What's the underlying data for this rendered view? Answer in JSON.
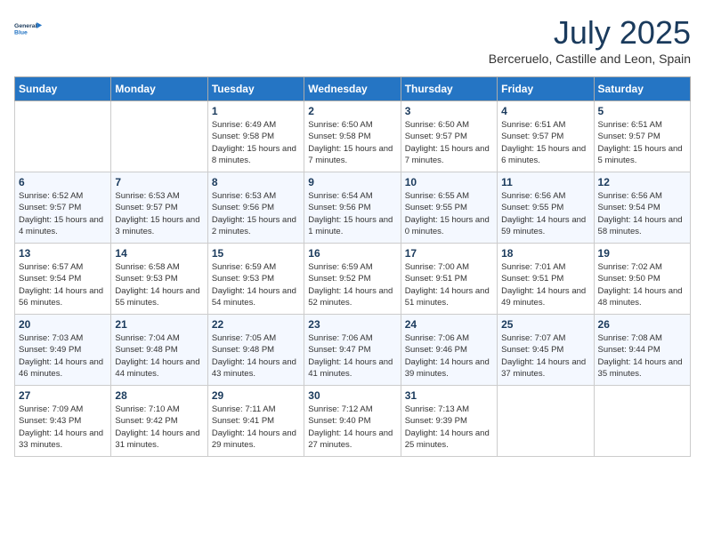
{
  "header": {
    "logo_line1": "General",
    "logo_line2": "Blue",
    "month": "July 2025",
    "location": "Berceruelo, Castille and Leon, Spain"
  },
  "days_of_week": [
    "Sunday",
    "Monday",
    "Tuesday",
    "Wednesday",
    "Thursday",
    "Friday",
    "Saturday"
  ],
  "weeks": [
    [
      {
        "num": "",
        "info": ""
      },
      {
        "num": "",
        "info": ""
      },
      {
        "num": "1",
        "info": "Sunrise: 6:49 AM\nSunset: 9:58 PM\nDaylight: 15 hours and 8 minutes."
      },
      {
        "num": "2",
        "info": "Sunrise: 6:50 AM\nSunset: 9:58 PM\nDaylight: 15 hours and 7 minutes."
      },
      {
        "num": "3",
        "info": "Sunrise: 6:50 AM\nSunset: 9:57 PM\nDaylight: 15 hours and 7 minutes."
      },
      {
        "num": "4",
        "info": "Sunrise: 6:51 AM\nSunset: 9:57 PM\nDaylight: 15 hours and 6 minutes."
      },
      {
        "num": "5",
        "info": "Sunrise: 6:51 AM\nSunset: 9:57 PM\nDaylight: 15 hours and 5 minutes."
      }
    ],
    [
      {
        "num": "6",
        "info": "Sunrise: 6:52 AM\nSunset: 9:57 PM\nDaylight: 15 hours and 4 minutes."
      },
      {
        "num": "7",
        "info": "Sunrise: 6:53 AM\nSunset: 9:57 PM\nDaylight: 15 hours and 3 minutes."
      },
      {
        "num": "8",
        "info": "Sunrise: 6:53 AM\nSunset: 9:56 PM\nDaylight: 15 hours and 2 minutes."
      },
      {
        "num": "9",
        "info": "Sunrise: 6:54 AM\nSunset: 9:56 PM\nDaylight: 15 hours and 1 minute."
      },
      {
        "num": "10",
        "info": "Sunrise: 6:55 AM\nSunset: 9:55 PM\nDaylight: 15 hours and 0 minutes."
      },
      {
        "num": "11",
        "info": "Sunrise: 6:56 AM\nSunset: 9:55 PM\nDaylight: 14 hours and 59 minutes."
      },
      {
        "num": "12",
        "info": "Sunrise: 6:56 AM\nSunset: 9:54 PM\nDaylight: 14 hours and 58 minutes."
      }
    ],
    [
      {
        "num": "13",
        "info": "Sunrise: 6:57 AM\nSunset: 9:54 PM\nDaylight: 14 hours and 56 minutes."
      },
      {
        "num": "14",
        "info": "Sunrise: 6:58 AM\nSunset: 9:53 PM\nDaylight: 14 hours and 55 minutes."
      },
      {
        "num": "15",
        "info": "Sunrise: 6:59 AM\nSunset: 9:53 PM\nDaylight: 14 hours and 54 minutes."
      },
      {
        "num": "16",
        "info": "Sunrise: 6:59 AM\nSunset: 9:52 PM\nDaylight: 14 hours and 52 minutes."
      },
      {
        "num": "17",
        "info": "Sunrise: 7:00 AM\nSunset: 9:51 PM\nDaylight: 14 hours and 51 minutes."
      },
      {
        "num": "18",
        "info": "Sunrise: 7:01 AM\nSunset: 9:51 PM\nDaylight: 14 hours and 49 minutes."
      },
      {
        "num": "19",
        "info": "Sunrise: 7:02 AM\nSunset: 9:50 PM\nDaylight: 14 hours and 48 minutes."
      }
    ],
    [
      {
        "num": "20",
        "info": "Sunrise: 7:03 AM\nSunset: 9:49 PM\nDaylight: 14 hours and 46 minutes."
      },
      {
        "num": "21",
        "info": "Sunrise: 7:04 AM\nSunset: 9:48 PM\nDaylight: 14 hours and 44 minutes."
      },
      {
        "num": "22",
        "info": "Sunrise: 7:05 AM\nSunset: 9:48 PM\nDaylight: 14 hours and 43 minutes."
      },
      {
        "num": "23",
        "info": "Sunrise: 7:06 AM\nSunset: 9:47 PM\nDaylight: 14 hours and 41 minutes."
      },
      {
        "num": "24",
        "info": "Sunrise: 7:06 AM\nSunset: 9:46 PM\nDaylight: 14 hours and 39 minutes."
      },
      {
        "num": "25",
        "info": "Sunrise: 7:07 AM\nSunset: 9:45 PM\nDaylight: 14 hours and 37 minutes."
      },
      {
        "num": "26",
        "info": "Sunrise: 7:08 AM\nSunset: 9:44 PM\nDaylight: 14 hours and 35 minutes."
      }
    ],
    [
      {
        "num": "27",
        "info": "Sunrise: 7:09 AM\nSunset: 9:43 PM\nDaylight: 14 hours and 33 minutes."
      },
      {
        "num": "28",
        "info": "Sunrise: 7:10 AM\nSunset: 9:42 PM\nDaylight: 14 hours and 31 minutes."
      },
      {
        "num": "29",
        "info": "Sunrise: 7:11 AM\nSunset: 9:41 PM\nDaylight: 14 hours and 29 minutes."
      },
      {
        "num": "30",
        "info": "Sunrise: 7:12 AM\nSunset: 9:40 PM\nDaylight: 14 hours and 27 minutes."
      },
      {
        "num": "31",
        "info": "Sunrise: 7:13 AM\nSunset: 9:39 PM\nDaylight: 14 hours and 25 minutes."
      },
      {
        "num": "",
        "info": ""
      },
      {
        "num": "",
        "info": ""
      }
    ]
  ]
}
